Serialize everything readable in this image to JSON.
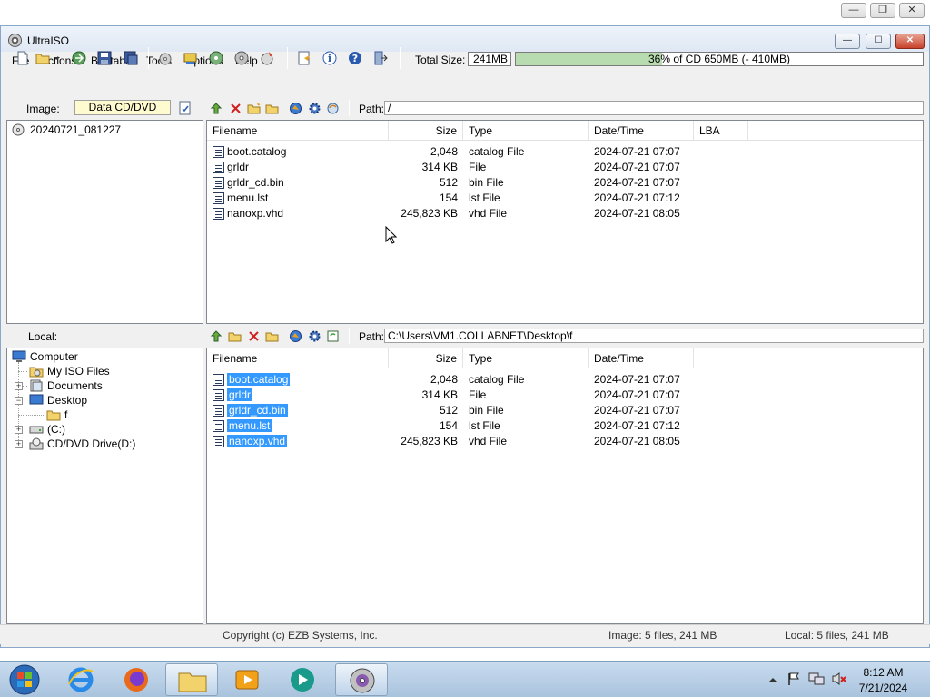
{
  "host": {
    "minimize": "—",
    "restore": "❐",
    "close": "✕"
  },
  "window": {
    "title": "UltraISO",
    "minimize": "—",
    "maximize": "☐",
    "close": "✕"
  },
  "menu": [
    "File",
    "Actions",
    "Bootable",
    "Tools",
    "Options",
    "Help"
  ],
  "toolbar": {
    "icons": [
      "new-icon",
      "open-icon",
      "open-dropdown-icon",
      "extract-icon",
      "save-icon",
      "save-as-icon",
      "burn-icon",
      "mount-icon",
      "compress-icon",
      "virtual-drive-icon",
      "make-cd-image-icon",
      "properties-icon",
      "info-icon",
      "help-icon",
      "exit-icon"
    ],
    "total_size_label": "Total Size:",
    "total_size_value": "241MB",
    "capacity_fraction": 0.36,
    "capacity_text": "36% of CD 650MB (- 410MB)"
  },
  "image_row": {
    "label": "Image:",
    "type": "Data CD/DVD",
    "path_label": "Path:",
    "path": "/"
  },
  "image_tree": {
    "root": "20240721_081227"
  },
  "columns": {
    "filename": "Filename",
    "size": "Size",
    "type": "Type",
    "datetime": "Date/Time",
    "lba": "LBA"
  },
  "image_files": [
    {
      "name": "boot.catalog",
      "size": "2,048",
      "type": "catalog File",
      "date": "2024-07-21 07:07"
    },
    {
      "name": "grldr",
      "size": "314 KB",
      "type": "File",
      "date": "2024-07-21 07:07"
    },
    {
      "name": "grldr_cd.bin",
      "size": "512",
      "type": "bin File",
      "date": "2024-07-21 07:07"
    },
    {
      "name": "menu.lst",
      "size": "154",
      "type": "lst File",
      "date": "2024-07-21 07:12"
    },
    {
      "name": "nanoxp.vhd",
      "size": "245,823 KB",
      "type": "vhd File",
      "date": "2024-07-21 08:05"
    }
  ],
  "local_row": {
    "label": "Local:",
    "path_label": "Path:",
    "path": "C:\\Users\\VM1.COLLABNET\\Desktop\\f"
  },
  "local_tree": [
    {
      "label": "Computer",
      "icon": "computer-icon"
    },
    {
      "label": "My ISO Files",
      "icon": "iso-folder-icon"
    },
    {
      "label": "Documents",
      "icon": "documents-icon"
    },
    {
      "label": "Desktop",
      "icon": "desktop-icon"
    },
    {
      "label": "f",
      "icon": "folder-icon"
    },
    {
      "label": "(C:)",
      "icon": "drive-icon"
    },
    {
      "label": "CD/DVD Drive(D:)",
      "icon": "cd-drive-icon"
    }
  ],
  "local_files": [
    {
      "name": "boot.catalog",
      "size": "2,048",
      "type": "catalog File",
      "date": "2024-07-21 07:07"
    },
    {
      "name": "grldr",
      "size": "314 KB",
      "type": "File",
      "date": "2024-07-21 07:07"
    },
    {
      "name": "grldr_cd.bin",
      "size": "512",
      "type": "bin File",
      "date": "2024-07-21 07:07"
    },
    {
      "name": "menu.lst",
      "size": "154",
      "type": "lst File",
      "date": "2024-07-21 07:12"
    },
    {
      "name": "nanoxp.vhd",
      "size": "245,823 KB",
      "type": "vhd File",
      "date": "2024-07-21 08:05"
    }
  ],
  "status": {
    "copyright": "Copyright (c) EZB Systems, Inc.",
    "image_info": "Image: 5 files, 241 MB",
    "local_info": "Local: 5 files, 241 MB"
  },
  "taskbar": {
    "apps": [
      "start-orb-icon",
      "internet-explorer-icon",
      "firefox-icon",
      "file-explorer-icon",
      "media-player-icon",
      "app-teal-icon",
      "ultraiso-taskbar-icon"
    ],
    "time": "8:12 AM",
    "date": "7/21/2024"
  }
}
